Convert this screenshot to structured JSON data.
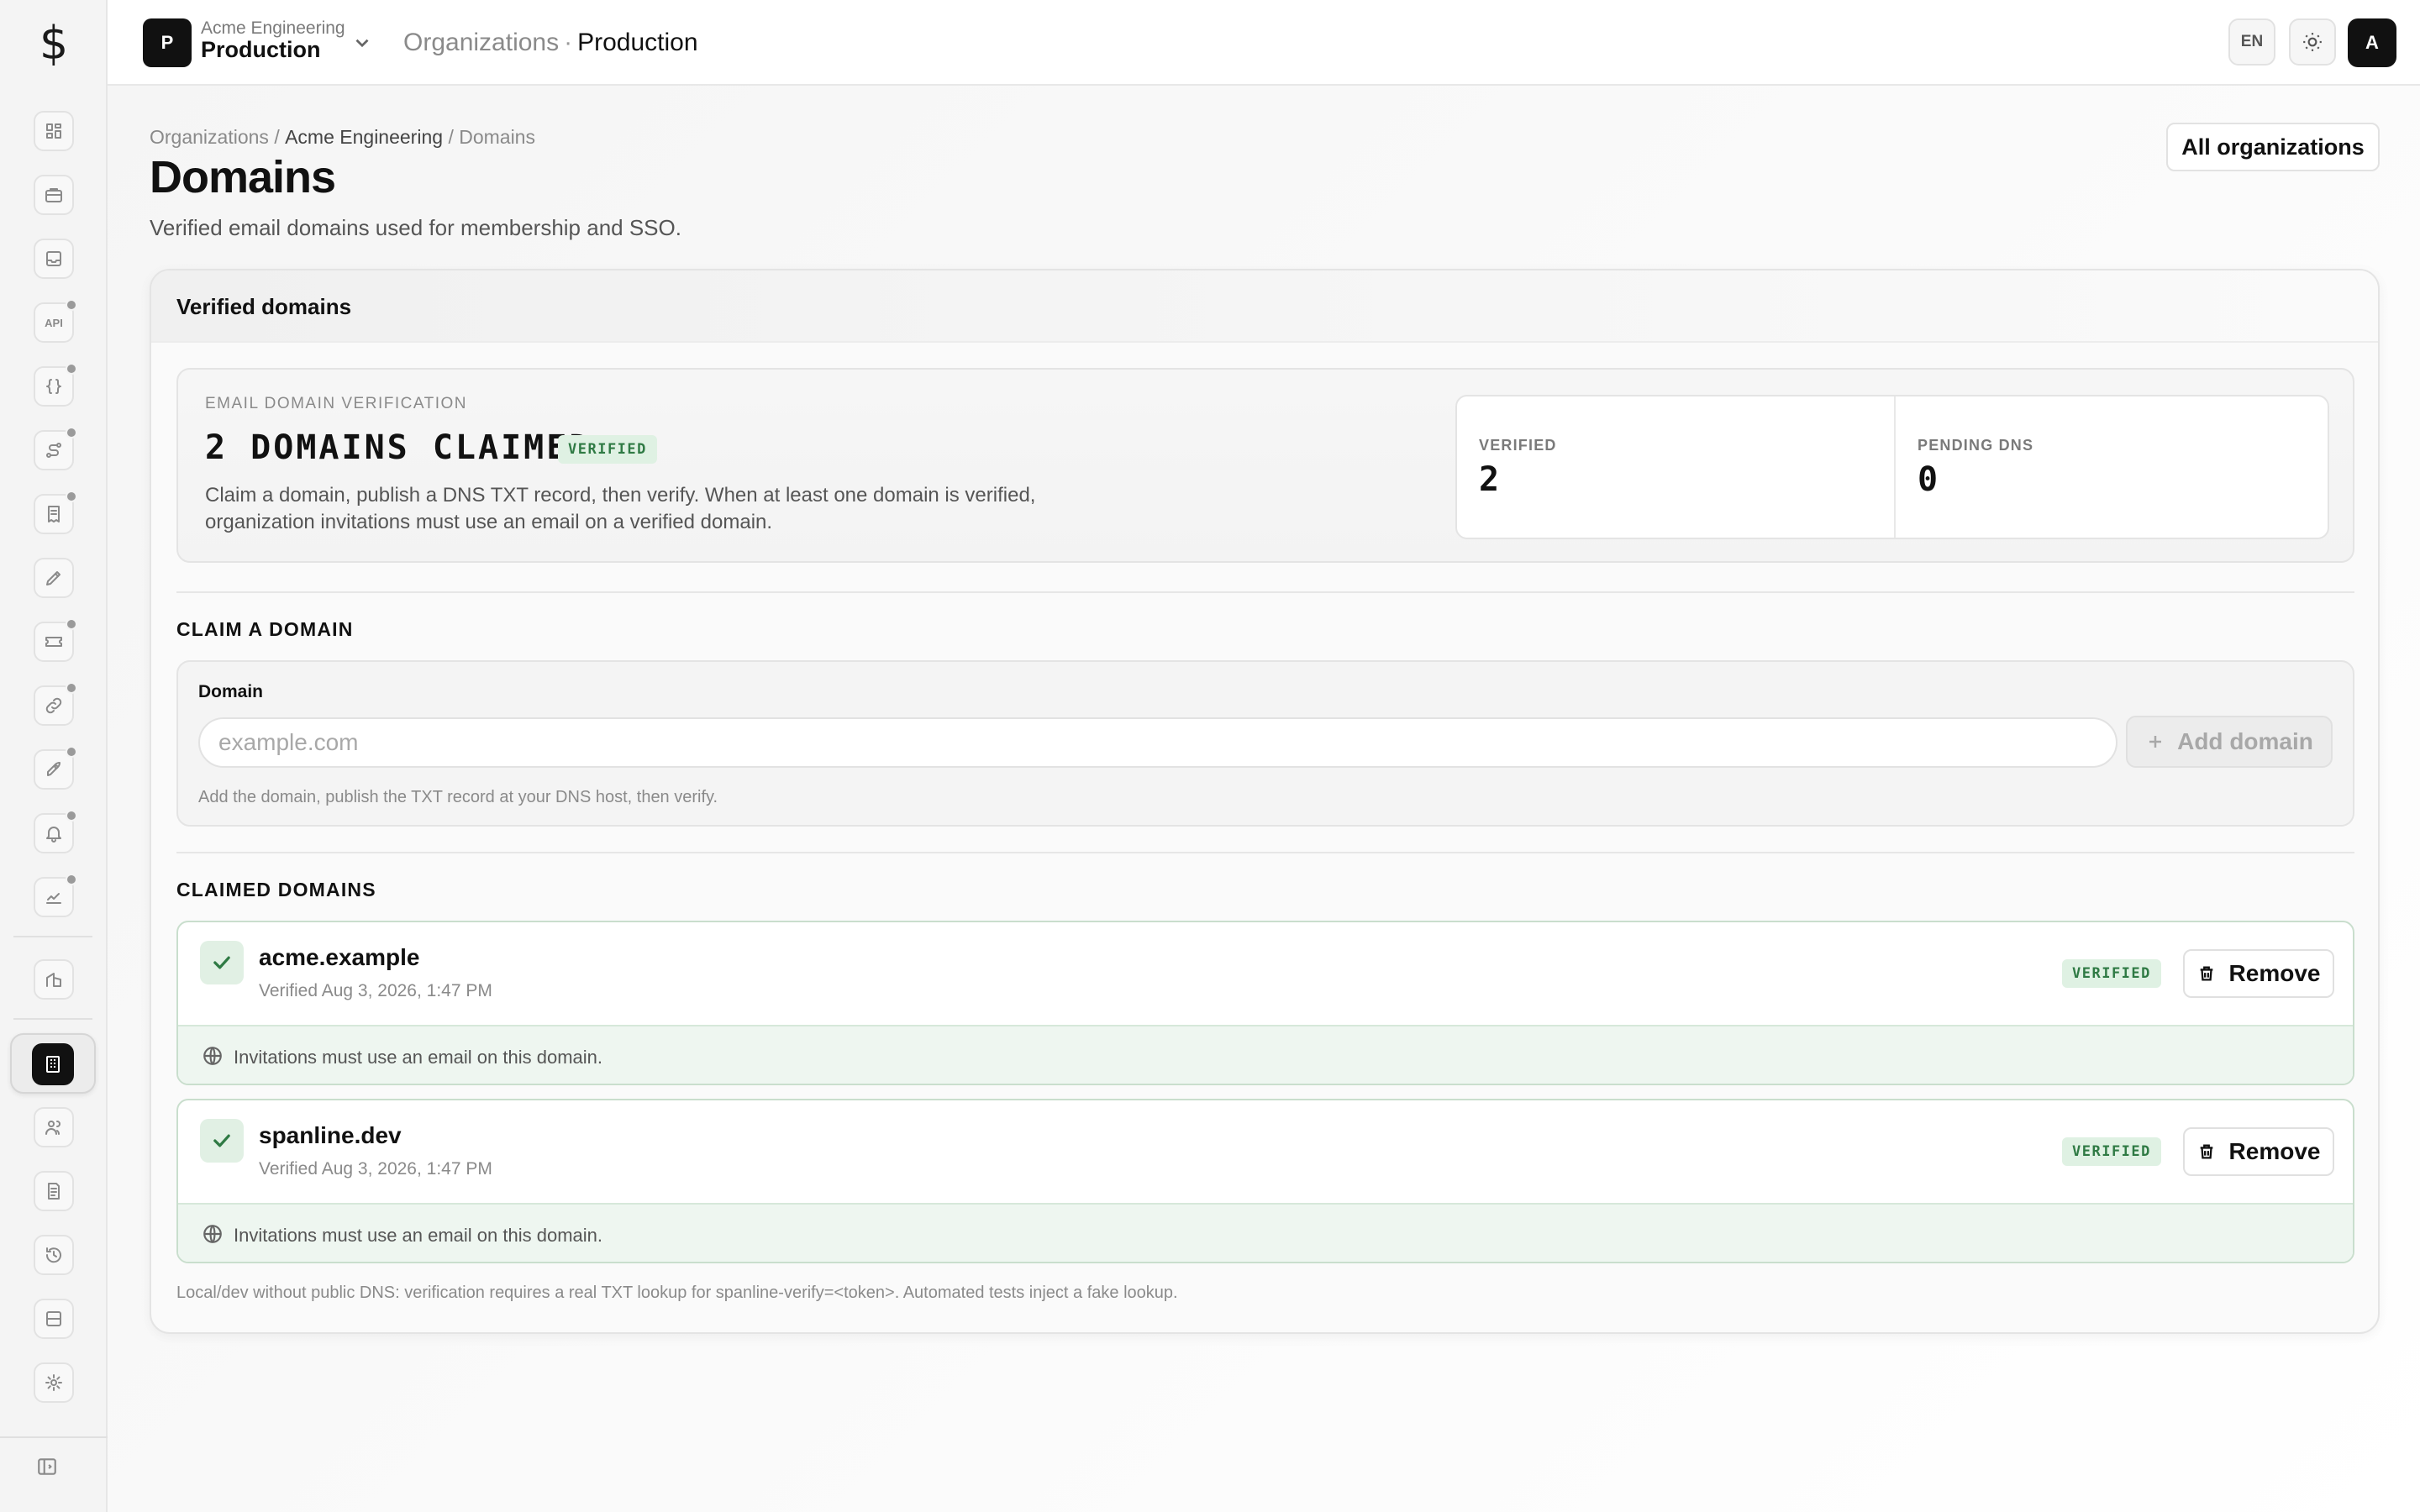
{
  "app": {
    "logo_glyph": "$"
  },
  "header": {
    "org_avatar": "P",
    "org_subtitle": "Acme Engineering",
    "org_name": "Production",
    "crumb_parent": "Organizations",
    "crumb_sep": "·",
    "crumb_current": "Production",
    "lang": "EN",
    "user_avatar": "A"
  },
  "sidebar": {
    "items": [
      {
        "icon": "dashboard-icon",
        "dot": false
      },
      {
        "icon": "briefcase-icon",
        "dot": false
      },
      {
        "icon": "inbox-icon",
        "dot": false
      },
      {
        "icon": "api-icon",
        "dot": true
      },
      {
        "icon": "code-braces-icon",
        "dot": true
      },
      {
        "icon": "workflow-icon",
        "dot": true
      },
      {
        "icon": "receipt-icon",
        "dot": true
      },
      {
        "icon": "pen-tool-icon",
        "dot": false
      },
      {
        "icon": "ticket-icon",
        "dot": true
      },
      {
        "icon": "link-icon",
        "dot": true
      },
      {
        "icon": "rocket-icon",
        "dot": true
      },
      {
        "icon": "bell-icon",
        "dot": true
      },
      {
        "icon": "chart-icon",
        "dot": true
      },
      {
        "icon": "building-icon",
        "dot": false
      },
      {
        "icon": "organization-icon",
        "active": true
      },
      {
        "icon": "users-icon",
        "dot": false
      },
      {
        "icon": "document-icon",
        "dot": false
      },
      {
        "icon": "history-icon",
        "dot": false
      },
      {
        "icon": "storage-icon",
        "dot": false
      },
      {
        "icon": "gear-icon",
        "dot": false
      }
    ],
    "api_label": "API"
  },
  "page": {
    "breadcrumb": {
      "root": "Organizations",
      "org": "Acme Engineering",
      "current": "Domains",
      "sep": "/"
    },
    "title": "Domains",
    "subtitle": "Verified email domains used for membership and SSO.",
    "all_orgs_button": "All organizations"
  },
  "card": {
    "title": "Verified domains",
    "summary": {
      "label": "EMAIL DOMAIN VERIFICATION",
      "count_text": "2 DOMAINS CLAIMED",
      "badge": "VERIFIED",
      "description": "Claim a domain, publish a DNS TXT record, then verify. When at least one domain is verified, organization invitations must use an email on a verified domain.",
      "stats": [
        {
          "label": "VERIFIED",
          "value": "2"
        },
        {
          "label": "PENDING DNS",
          "value": "0"
        }
      ]
    },
    "claim": {
      "section_title": "CLAIM A DOMAIN",
      "field_label": "Domain",
      "placeholder": "example.com",
      "value": "",
      "add_button": "Add domain",
      "help": "Add the domain, publish the TXT record at your DNS host, then verify."
    },
    "claimed": {
      "section_title": "CLAIMED DOMAINS",
      "domains": [
        {
          "name": "acme.example",
          "meta": "Verified Aug 3, 2026, 1:47 PM",
          "badge": "VERIFIED",
          "remove": "Remove",
          "footer": "Invitations must use an email on this domain."
        },
        {
          "name": "spanline.dev",
          "meta": "Verified Aug 3, 2026, 1:47 PM",
          "badge": "VERIFIED",
          "remove": "Remove",
          "footer": "Invitations must use an email on this domain."
        }
      ]
    },
    "note": "Local/dev without public DNS: verification requires a real TXT lookup for spanline-verify=<token>. Automated tests inject a fake lookup."
  }
}
